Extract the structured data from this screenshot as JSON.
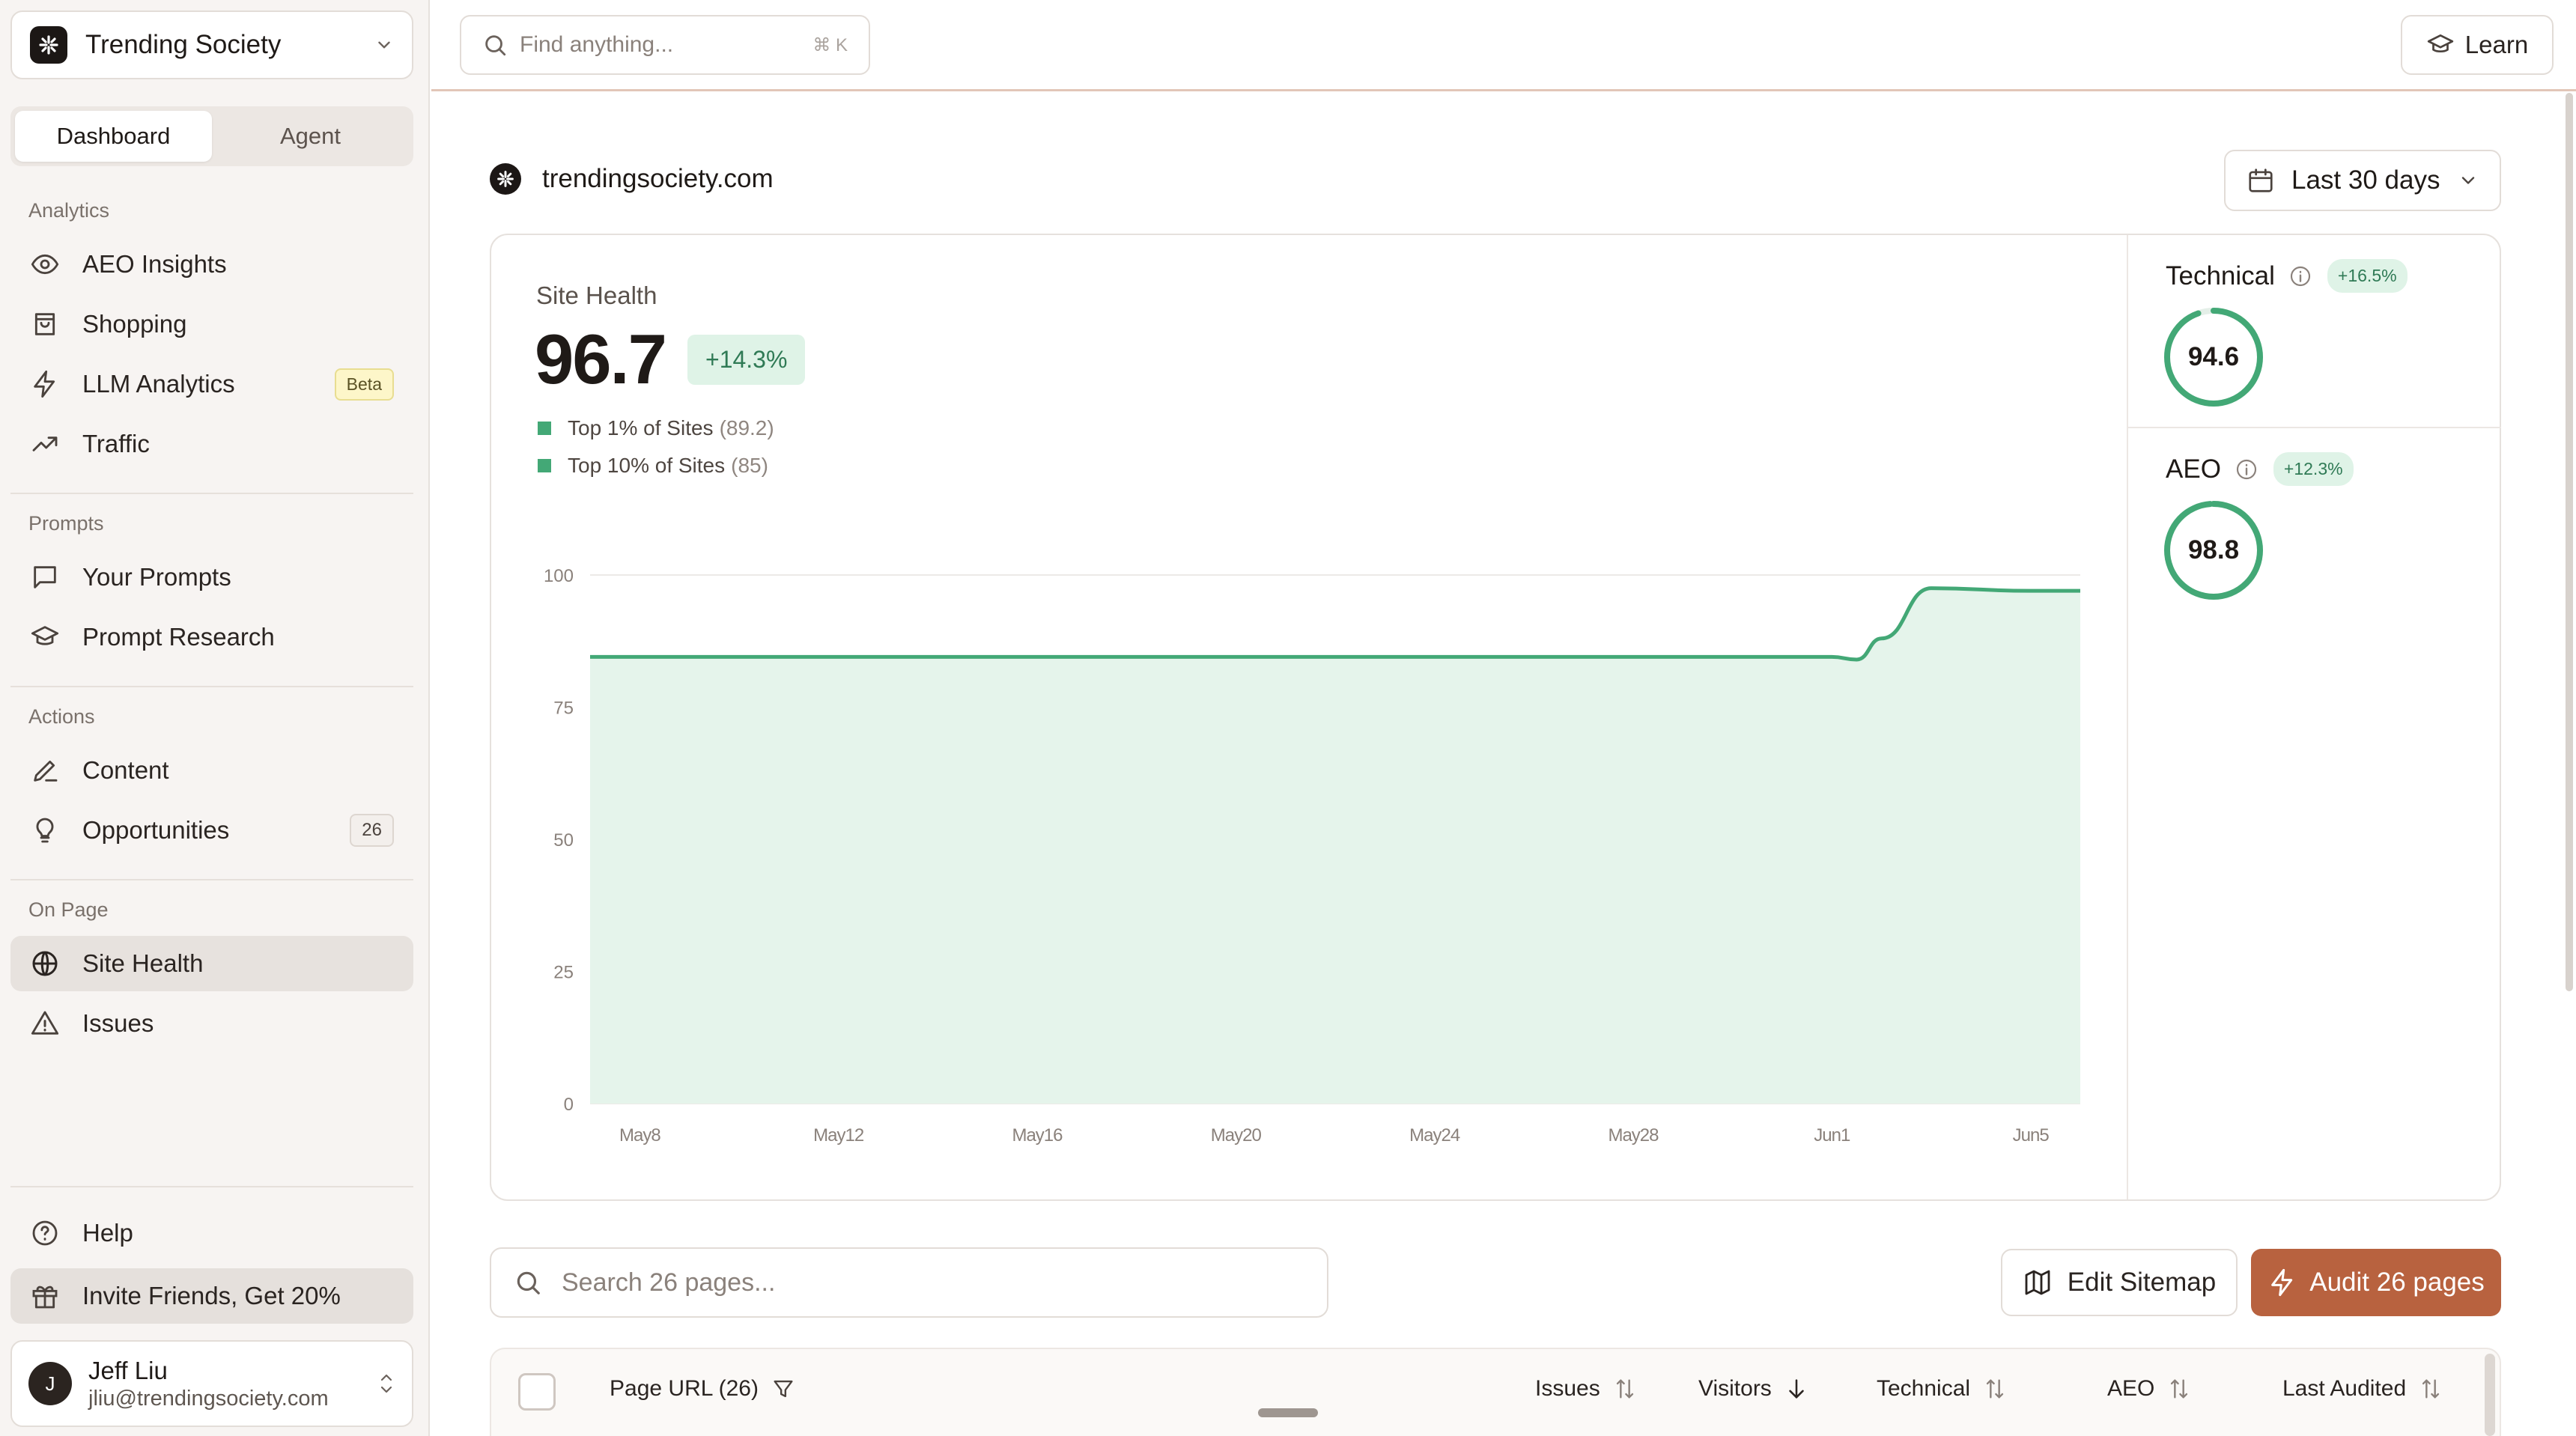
{
  "workspace": {
    "name": "Trending Society"
  },
  "tabs": [
    {
      "label": "Dashboard",
      "active": true
    },
    {
      "label": "Agent",
      "active": false
    }
  ],
  "sidebar": {
    "analytics_label": "Analytics",
    "analytics": [
      {
        "label": "AEO Insights",
        "icon": "eye-icon"
      },
      {
        "label": "Shopping",
        "icon": "shopping-bag-icon"
      },
      {
        "label": "LLM Analytics",
        "icon": "lightning-icon",
        "badge": "Beta"
      },
      {
        "label": "Traffic",
        "icon": "trending-up-icon"
      }
    ],
    "prompts_label": "Prompts",
    "prompts": [
      {
        "label": "Your Prompts",
        "icon": "chat-icon"
      },
      {
        "label": "Prompt Research",
        "icon": "graduation-cap-icon"
      }
    ],
    "actions_label": "Actions",
    "actions": [
      {
        "label": "Content",
        "icon": "pen-icon"
      },
      {
        "label": "Opportunities",
        "icon": "lightbulb-icon",
        "badge": "26"
      }
    ],
    "onpage_label": "On Page",
    "onpage": [
      {
        "label": "Site Health",
        "icon": "globe-icon",
        "active": true
      },
      {
        "label": "Issues",
        "icon": "warning-icon"
      }
    ],
    "help": "Help",
    "invite": "Invite Friends, Get 20%"
  },
  "user": {
    "initial": "J",
    "name": "Jeff Liu",
    "email": "jliu@trendingsociety.com"
  },
  "topbar": {
    "search_placeholder": "Find anything...",
    "shortcut": "⌘ K",
    "learn": "Learn"
  },
  "site": {
    "domain": "trendingsociety.com",
    "range": "Last 30 days"
  },
  "site_health": {
    "label": "Site Health",
    "value": "96.7",
    "delta": "+14.3%",
    "legend": [
      {
        "label": "Top 1% of Sites",
        "value": "(89.2)"
      },
      {
        "label": "Top 10% of Sites",
        "value": "(85)"
      }
    ]
  },
  "metrics": {
    "technical": {
      "label": "Technical",
      "delta": "+16.5%",
      "value": "94.6",
      "score": 94.6
    },
    "aeo": {
      "label": "AEO",
      "delta": "+12.3%",
      "value": "98.8",
      "score": 98.8
    }
  },
  "chart_data": {
    "type": "area",
    "x": [
      "May 7",
      "May 8",
      "May 12",
      "May 16",
      "May 20",
      "May 24",
      "May 28",
      "Jun 1",
      "Jun 1.5",
      "Jun 2",
      "Jun 3",
      "Jun 5",
      "Jun 6"
    ],
    "xticks": [
      "May 8",
      "May 12",
      "May 16",
      "May 20",
      "May 24",
      "May 28",
      "Jun 1",
      "Jun 5"
    ],
    "yticks": [
      100,
      75,
      50,
      25,
      0
    ],
    "ylim": [
      0,
      100
    ],
    "values": [
      84.5,
      84.5,
      84.5,
      84.5,
      84.5,
      84.5,
      84.5,
      84.5,
      84.0,
      88.0,
      97.5,
      97.0,
      97.0
    ],
    "color": "#43a876",
    "fill": "#e5f4eb",
    "grid": true
  },
  "page_search_placeholder": "Search 26 pages...",
  "buttons": {
    "edit_sitemap": "Edit Sitemap",
    "audit": "Audit 26 pages"
  },
  "table": {
    "columns": [
      "Page URL (26)",
      "Issues",
      "Visitors",
      "Technical",
      "AEO",
      "Last Audited"
    ]
  },
  "colors": {
    "accent": "#b8623f",
    "green": "#43a876",
    "green_bg": "#dff3e7"
  }
}
